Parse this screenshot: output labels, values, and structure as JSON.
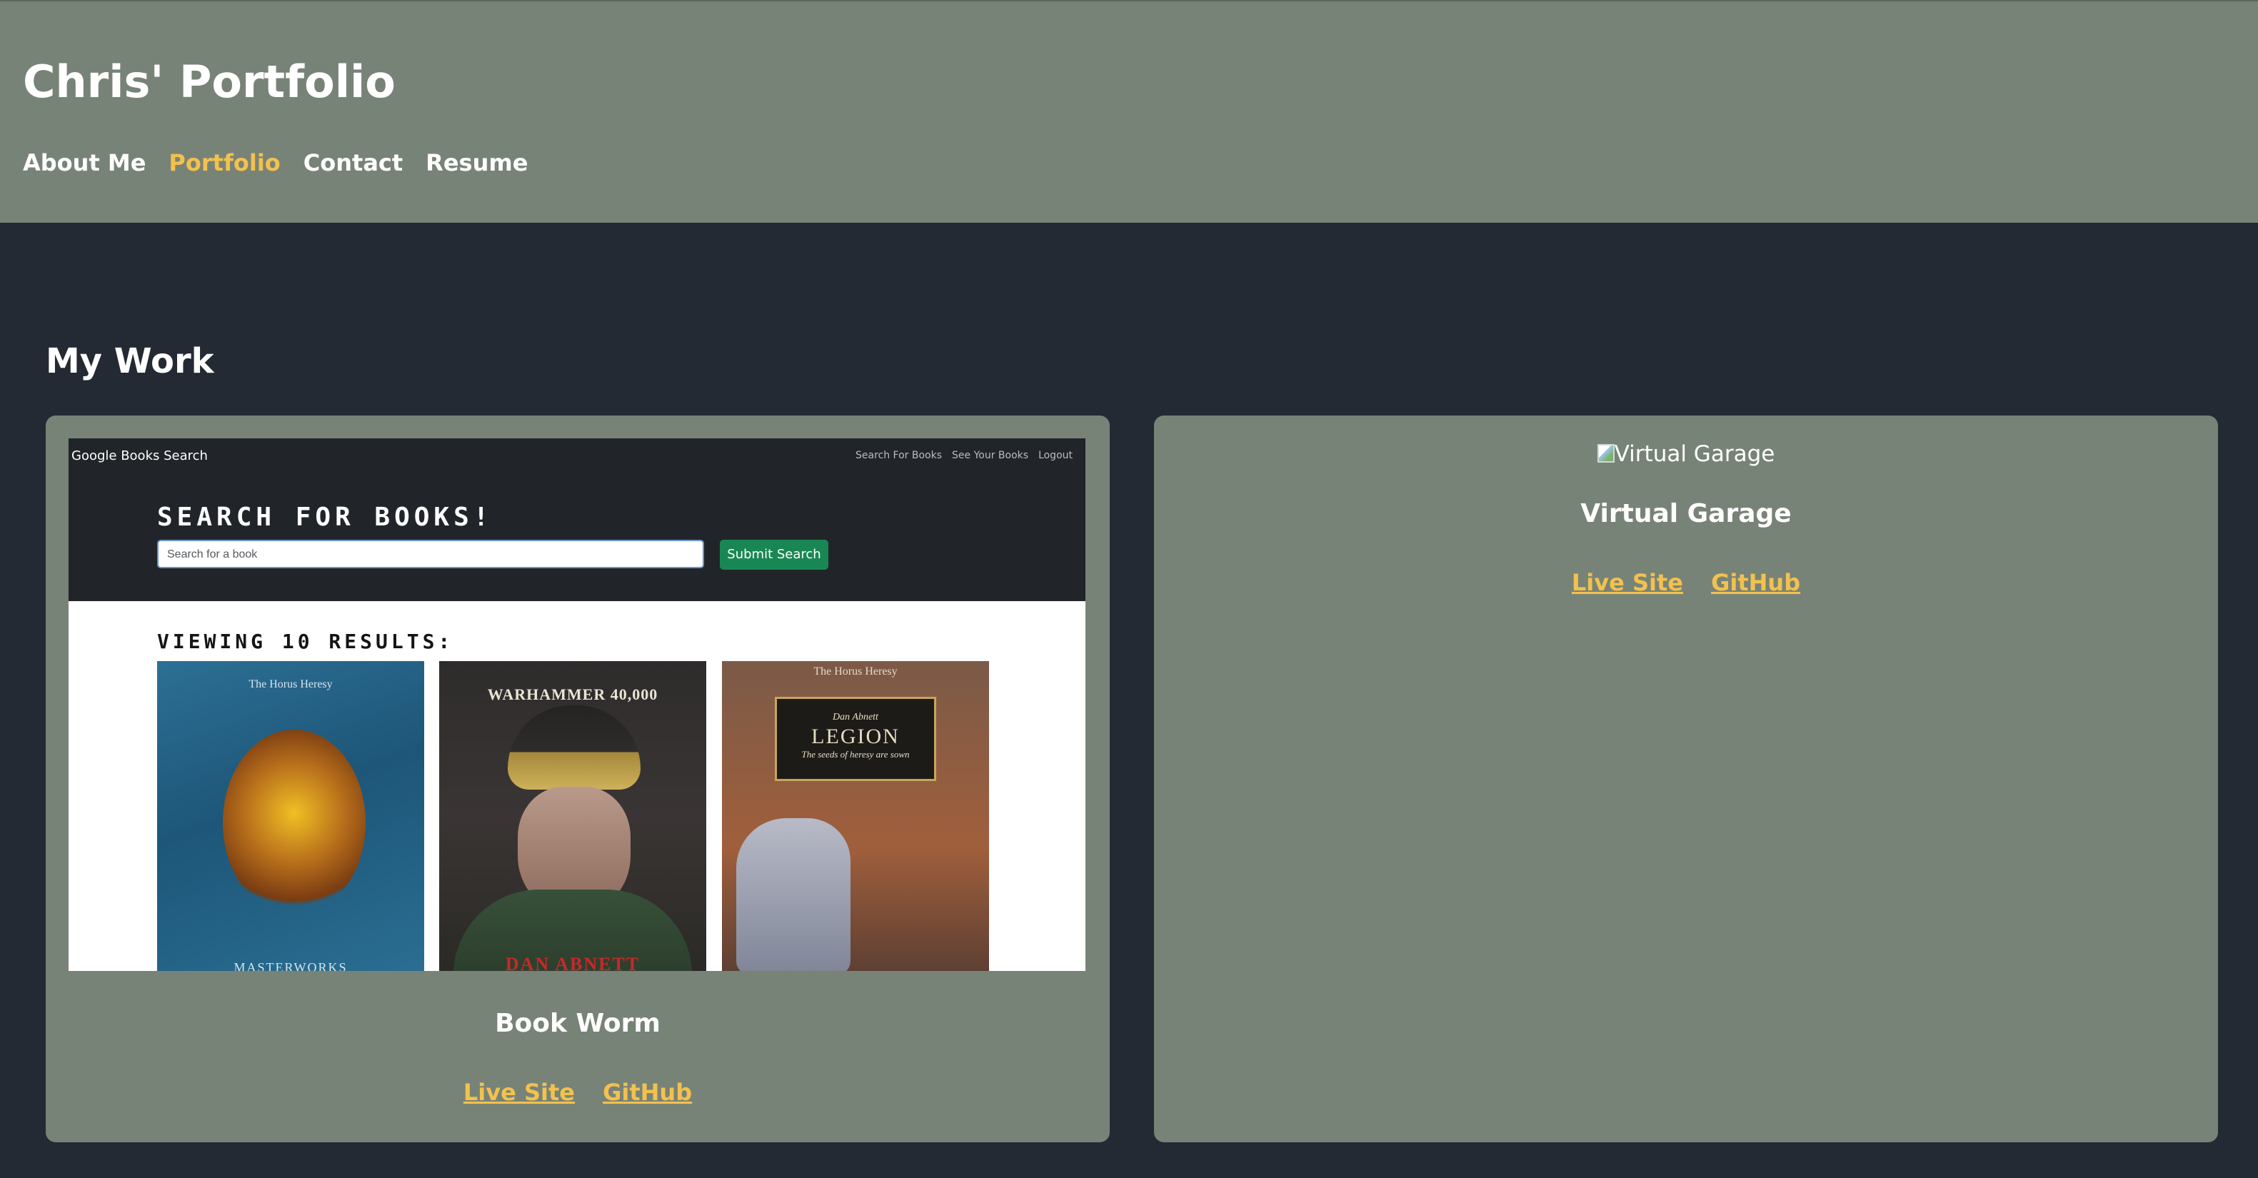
{
  "header": {
    "title": "Chris' Portfolio",
    "nav": [
      {
        "label": "About Me",
        "active": false
      },
      {
        "label": "Portfolio",
        "active": true
      },
      {
        "label": "Contact",
        "active": false
      },
      {
        "label": "Resume",
        "active": false
      }
    ]
  },
  "main": {
    "section_title": "My Work",
    "projects": [
      {
        "name": "Book Worm",
        "live_label": "Live Site",
        "github_label": "GitHub",
        "screenshot": {
          "brand": "Google Books Search",
          "nav": [
            "Search For Books",
            "See Your Books",
            "Logout"
          ],
          "heading": "SEARCH FOR BOOKS!",
          "search_placeholder": "Search for a book",
          "submit_label": "Submit Search",
          "results_label": "VIEWING 10 RESULTS:",
          "books": [
            {
              "top_text": "The Horus Heresy",
              "bottom_text": "MASTERWORKS"
            },
            {
              "top_text": "WARHAMMER 40,000",
              "bottom_text": "DAN ABNETT"
            },
            {
              "top_text": "The Horus Heresy",
              "author": "Dan Abnett",
              "title": "LEGION",
              "tagline": "The seeds of heresy are sown"
            }
          ]
        }
      },
      {
        "name": "Virtual Garage",
        "image_alt": "Virtual Garage",
        "live_label": "Live Site",
        "github_label": "GitHub"
      }
    ]
  },
  "colors": {
    "header_bg": "#788377",
    "page_bg": "#232a33",
    "card_bg": "#788377",
    "accent": "#f2c14e",
    "text": "#ffffff"
  }
}
